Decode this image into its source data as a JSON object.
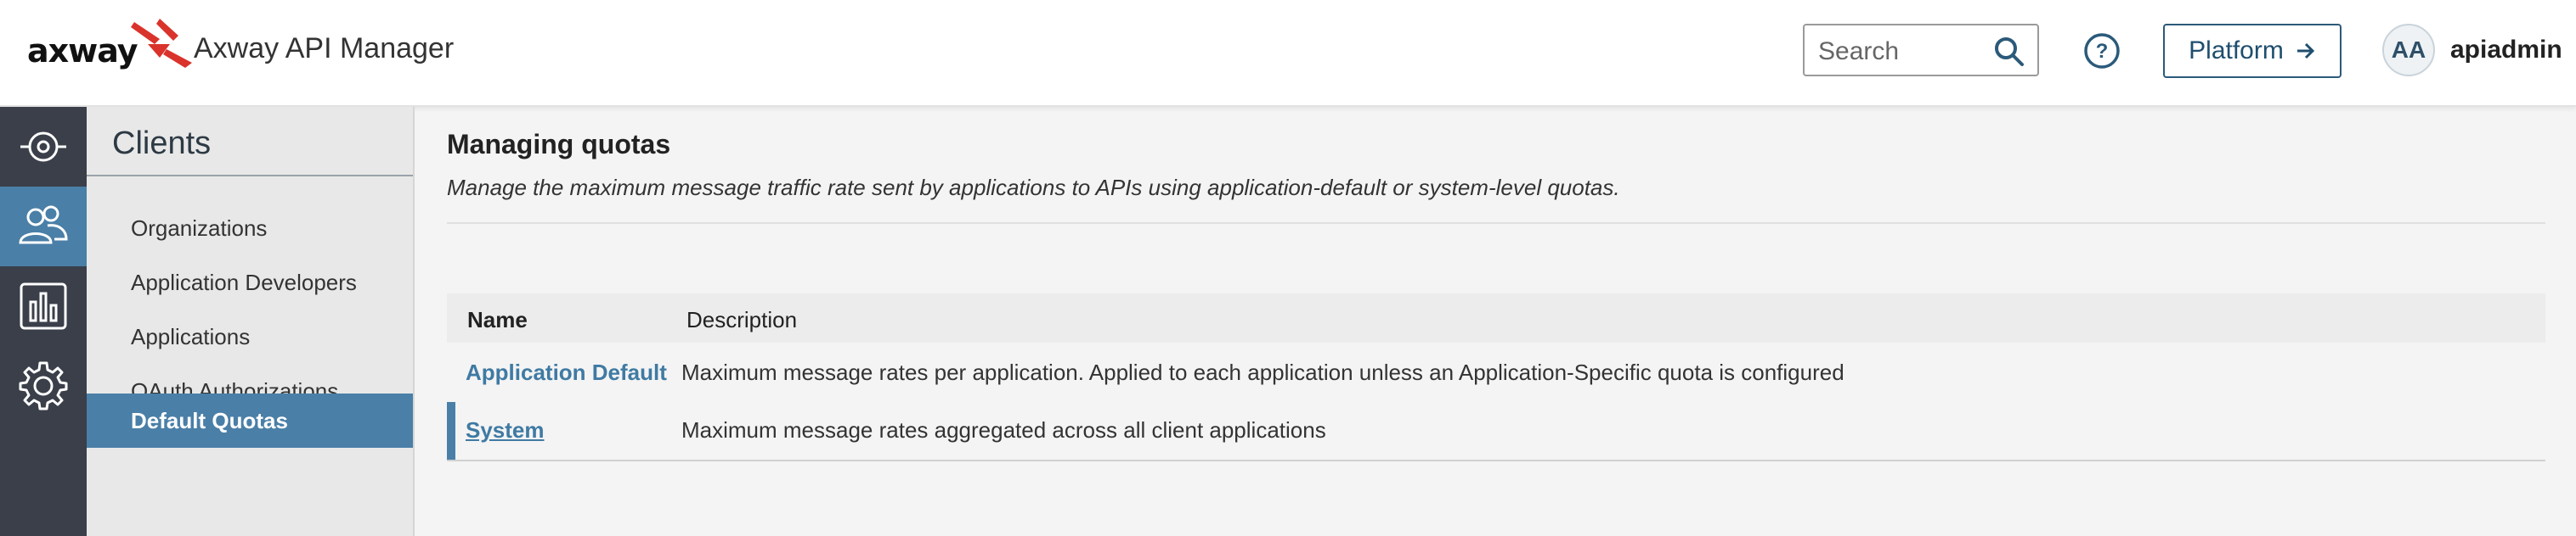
{
  "header": {
    "logo_text": "axway",
    "app_title": "Axway API Manager",
    "search_placeholder": "Search",
    "platform_label": "Platform",
    "avatar_initials": "AA",
    "username": "apiadmin"
  },
  "rail": {
    "items": [
      {
        "icon": "api-target-icon"
      },
      {
        "icon": "users-icon",
        "active": true
      },
      {
        "icon": "analytics-icon"
      },
      {
        "icon": "settings-gear-icon"
      }
    ]
  },
  "sidebar": {
    "heading": "Clients",
    "items": [
      {
        "label": "Organizations"
      },
      {
        "label": "Application Developers"
      },
      {
        "label": "Applications"
      },
      {
        "label": "OAuth Authorizations"
      },
      {
        "label": "Default Quotas",
        "active": true
      }
    ]
  },
  "main": {
    "title": "Managing quotas",
    "description": "Manage the maximum message traffic rate sent by applications to APIs using application-default or system-level quotas.",
    "table": {
      "columns": [
        "Name",
        "Description"
      ],
      "rows": [
        {
          "name": "Application Default",
          "description": "Maximum message rates per application. Applied to each application unless an Application-Specific quota is configured"
        },
        {
          "name": "System",
          "description": "Maximum message rates aggregated across all client applications",
          "selected": true
        }
      ]
    }
  },
  "colors": {
    "accent": "#4a7fa7",
    "rail_bg": "#3a3f4a",
    "logo_red": "#d9332b",
    "link": "#3f7aa3"
  }
}
